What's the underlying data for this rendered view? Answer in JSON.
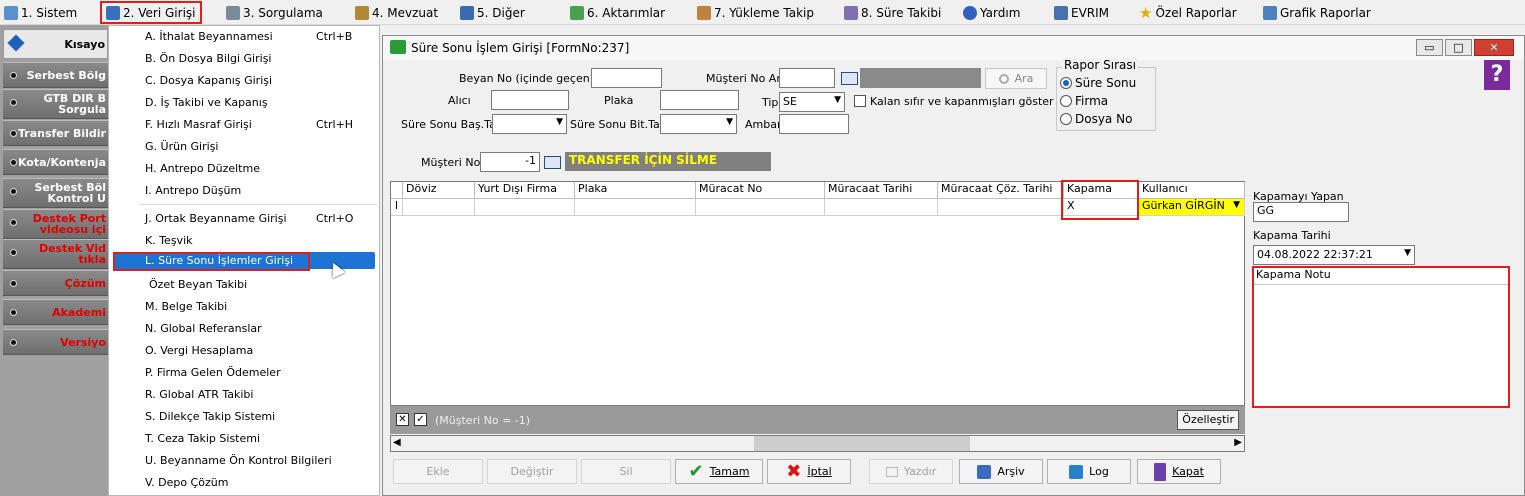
{
  "menu": [
    {
      "label": "1.  Sistem",
      "icon": "system-icon"
    },
    {
      "label": "2.  Veri Girişi",
      "icon": "data-entry-icon"
    },
    {
      "label": "3.  Sorgulama",
      "icon": "query-icon"
    },
    {
      "label": "4.  Mevzuat",
      "icon": "legislation-icon"
    },
    {
      "label": "5.  Diğer",
      "icon": "other-icon"
    },
    {
      "label": "6.  Aktarımlar",
      "icon": "transfer-icon"
    },
    {
      "label": "7.  Yükleme Takip",
      "icon": "upload-tracking-icon"
    },
    {
      "label": "8. Süre Takibi",
      "icon": "time-tracking-icon"
    },
    {
      "label": "Yardım",
      "icon": "help-icon"
    },
    {
      "label": "EVRIM",
      "icon": "evrim-icon"
    },
    {
      "label": "Özel Raporlar",
      "icon": "star-icon"
    },
    {
      "label": "Grafik Raporlar",
      "icon": "chart-report-icon"
    }
  ],
  "sidebar": {
    "top": "Kısayo",
    "items": [
      {
        "label": "Serbest Bölg",
        "red": false
      },
      {
        "label": "GTB DIR B\nSorgula",
        "red": false
      },
      {
        "label": "Transfer Bildir",
        "red": false
      },
      {
        "label": "Kota/Kontenja",
        "red": false
      },
      {
        "label": "Serbest Böl\nKontrol U",
        "red": false
      },
      {
        "label": "Destek Port\nvideosu içi",
        "red": true
      },
      {
        "label": "Destek Vid\ntıkla",
        "red": true
      },
      {
        "label": "Çözüm",
        "red": true
      },
      {
        "label": "Akademi",
        "red": true
      },
      {
        "label": "Versiyo",
        "red": true
      }
    ]
  },
  "dropdown": [
    {
      "label": "A.  İthalat Beyannamesi",
      "shortcut": "Ctrl+B"
    },
    {
      "label": "B.  Ön Dosya Bilgi Girişi",
      "shortcut": ""
    },
    {
      "label": "C.  Dosya Kapanış Girişi",
      "shortcut": ""
    },
    {
      "label": "D.  İş Takibi ve Kapanış",
      "shortcut": ""
    },
    {
      "label": "F.  Hızlı Masraf Girişi",
      "shortcut": "Ctrl+H"
    },
    {
      "label": "G.  Ürün Girişi",
      "shortcut": ""
    },
    {
      "label": "H.  Antrepo Düzeltme",
      "shortcut": ""
    },
    {
      "label": "I.   Antrepo Düşüm",
      "shortcut": ""
    },
    {
      "label": "J.  Ortak Beyanname Girişi",
      "shortcut": "Ctrl+O"
    },
    {
      "label": "K.  Teşvik",
      "shortcut": ""
    },
    {
      "label": "L.  Süre Sonu İşlemler Girişi",
      "shortcut": ""
    },
    {
      "label": "Özet Beyan Takibi",
      "shortcut": ""
    },
    {
      "label": "M.  Belge Takibi",
      "shortcut": ""
    },
    {
      "label": "N.  Global Referanslar",
      "shortcut": ""
    },
    {
      "label": "O. Vergi Hesaplama",
      "shortcut": ""
    },
    {
      "label": "P. Firma Gelen Ödemeler",
      "shortcut": ""
    },
    {
      "label": "R. Global ATR Takibi",
      "shortcut": ""
    },
    {
      "label": "S. Dilekçe Takip Sistemi",
      "shortcut": ""
    },
    {
      "label": "T. Ceza Takip Sistemi",
      "shortcut": ""
    },
    {
      "label": "U. Beyanname Ön Kontrol Bilgileri",
      "shortcut": ""
    },
    {
      "label": "V. Depo Çözüm",
      "shortcut": ""
    }
  ],
  "window": {
    "title": "Süre Sonu İşlem Girişi [FormNo:237]",
    "labels": {
      "beyan_no": "Beyan No (içinde geçen)",
      "musteri_ara": "Müşteri No Ara",
      "alici": "Alıcı",
      "plaka": "Plaka",
      "tip": "Tip",
      "kalan": "Kalan sıfır ve kapanmışları göster",
      "sure_bas": "Süre Sonu Baş.Tar",
      "sure_bit": "Süre Sonu Bit.Tar",
      "ambar": "Ambar",
      "musteri_no": "Müşteri No",
      "ara_btn": "Ara"
    },
    "tip_value": "SE",
    "musteri_no_value": "-1",
    "transfer_banner": "TRANSFER İÇİN SİLME",
    "rapor": {
      "title": "Rapor Sırası",
      "options": [
        "Süre Sonu",
        "Firma",
        "Dosya No"
      ],
      "selected": 0
    },
    "grid": {
      "columns": [
        "Döviz",
        "Yurt Dışı Firma",
        "Plaka",
        "Müracat No",
        "Müracaat Tarihi",
        "Müracaat Çöz. Tarihi",
        "Kapama",
        "Kullanıcı"
      ],
      "row": {
        "row_marker": "I",
        "kapama": "X",
        "kullanici": "Gürkan GİRGİN"
      },
      "filter_text": "(Müşteri No = -1)",
      "customize": "Özelleştir"
    },
    "right_panel": {
      "kapamayi_yapan_label": "Kapamayı Yapan",
      "kapamayi_yapan_value": "GG",
      "kapama_tarihi_label": "Kapama Tarihi",
      "kapama_tarihi_value": "04.08.2022 22:37:21",
      "kapama_notu_label": "Kapama Notu"
    },
    "buttons": {
      "ekle": "Ekle",
      "degistir": "Değiştir",
      "sil": "Sil",
      "tamam": "Tamam",
      "iptal": "İptal",
      "yazdir": "Yazdır",
      "arsiv": "Arşiv",
      "log": "Log",
      "kapat": "Kapat"
    }
  },
  "colors": {
    "highlight_red": "#e01e1e",
    "selection_blue": "#1e74d4",
    "banner_yellow": "#ffff00",
    "user_field_yellow": "#ffff00"
  }
}
